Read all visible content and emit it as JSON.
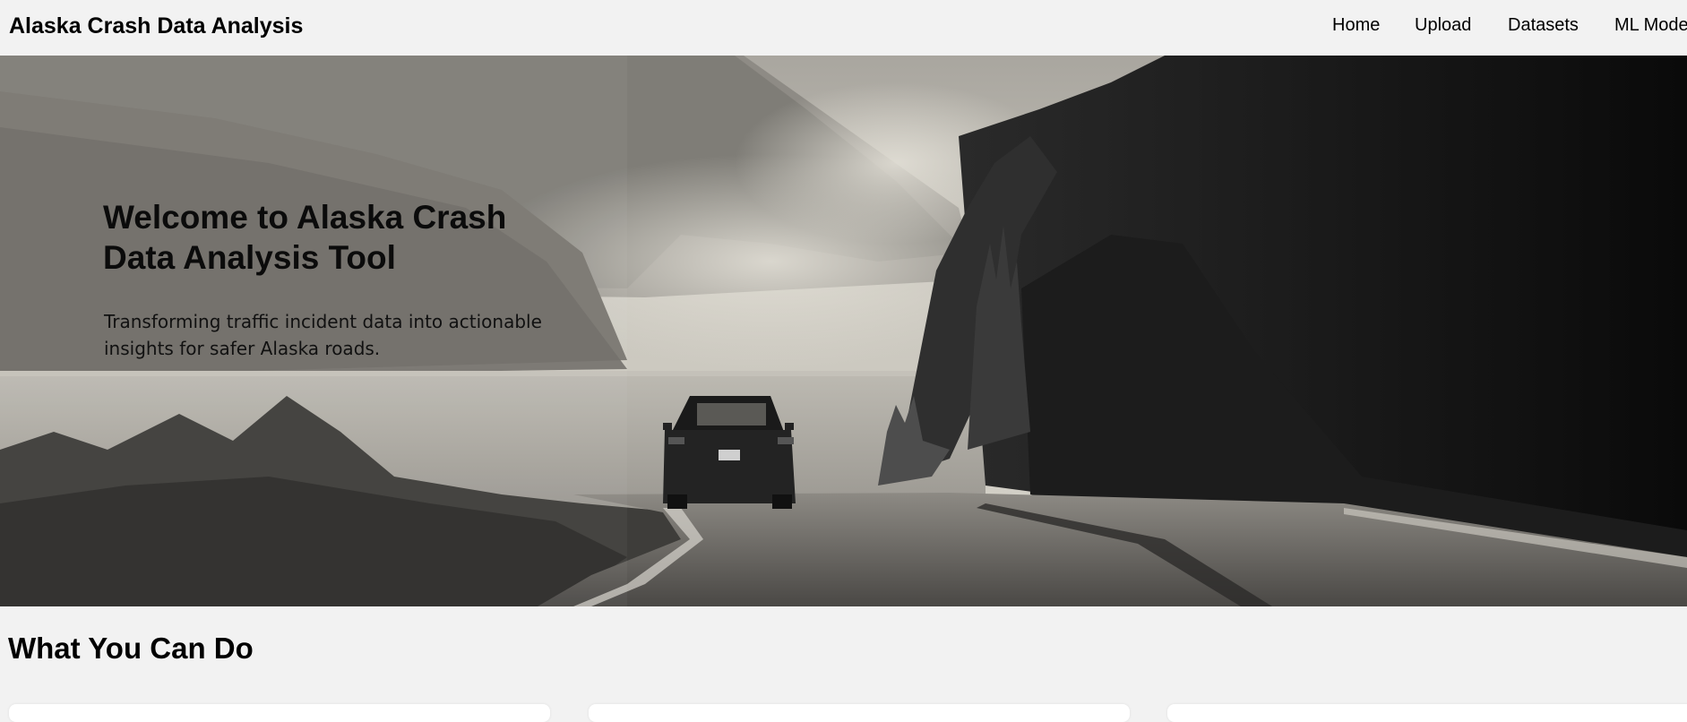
{
  "app": {
    "title": "Alaska Crash Data Analysis"
  },
  "nav": {
    "items": [
      {
        "label": "Home"
      },
      {
        "label": "Upload"
      },
      {
        "label": "Datasets"
      },
      {
        "label": "ML Mode"
      }
    ]
  },
  "hero": {
    "title": "Welcome to Alaska Crash Data Analysis Tool",
    "subtitle": "Transforming traffic incident data into actionable insights for safer Alaska roads."
  },
  "features": {
    "heading": "What You Can Do"
  },
  "colors": {
    "page_background": "#f2f2f2",
    "card_background": "#ffffff",
    "text": "#000000"
  }
}
